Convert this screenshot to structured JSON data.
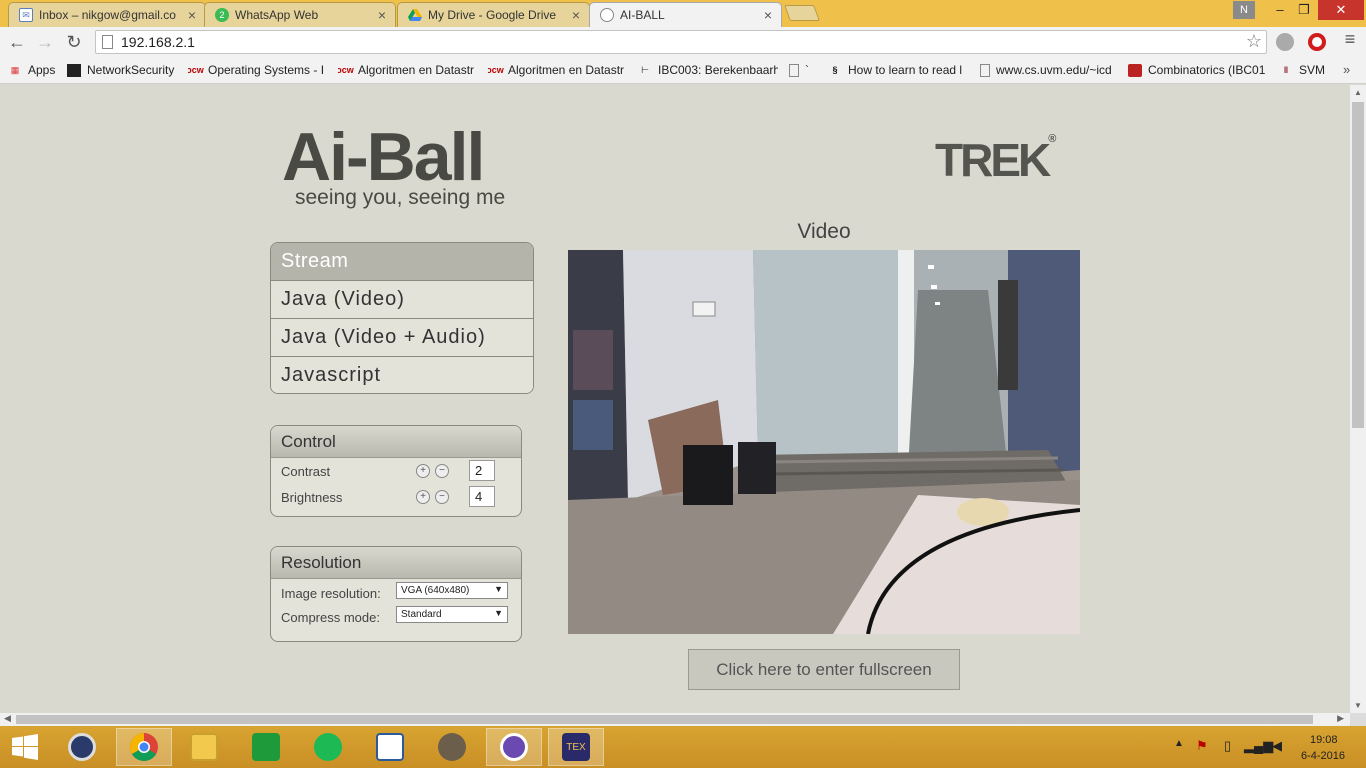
{
  "browser": {
    "tabs": [
      {
        "label": "Inbox – nikgow@gmail.co",
        "icon": "mail-icon"
      },
      {
        "label": "WhatsApp Web",
        "icon": "whatsapp-icon",
        "badge": "2"
      },
      {
        "label": "My Drive - Google Drive",
        "icon": "drive-icon"
      },
      {
        "label": "AI-BALL",
        "icon": "page-icon"
      }
    ],
    "profile": "N",
    "url": "192.168.2.1",
    "bookmarks": [
      {
        "label": "Apps"
      },
      {
        "label": "NetworkSecurity"
      },
      {
        "label": "Operating Systems - I"
      },
      {
        "label": "Algoritmen en Datastr"
      },
      {
        "label": "Algoritmen en Datastr"
      },
      {
        "label": "IBC003: Berekenbaarh"
      },
      {
        "label": "`"
      },
      {
        "label": "How to learn to read l"
      },
      {
        "label": "www.cs.uvm.edu/~icd"
      },
      {
        "label": "Combinatorics (IBC01("
      },
      {
        "label": "SVM"
      }
    ]
  },
  "page": {
    "logo_main": "Ai-Ball",
    "logo_tagline": "seeing you, seeing me",
    "logo_trek": "TREK",
    "stream": {
      "header": "Stream",
      "items": [
        "Java (Video)",
        "Java (Video + Audio)",
        "Javascript"
      ]
    },
    "control": {
      "header": "Control",
      "contrast_label": "Contrast",
      "contrast_value": "2",
      "brightness_label": "Brightness",
      "brightness_value": "4",
      "plus": "+",
      "minus": "−"
    },
    "resolution": {
      "header": "Resolution",
      "image_label": "Image resolution:",
      "image_value": "VGA (640x480)",
      "compress_label": "Compress mode:",
      "compress_value": "Standard"
    },
    "video_title": "Video",
    "fullscreen_button": "Click here to enter fullscreen"
  },
  "taskbar": {
    "time": "19:08",
    "date": "6-4-2016"
  }
}
